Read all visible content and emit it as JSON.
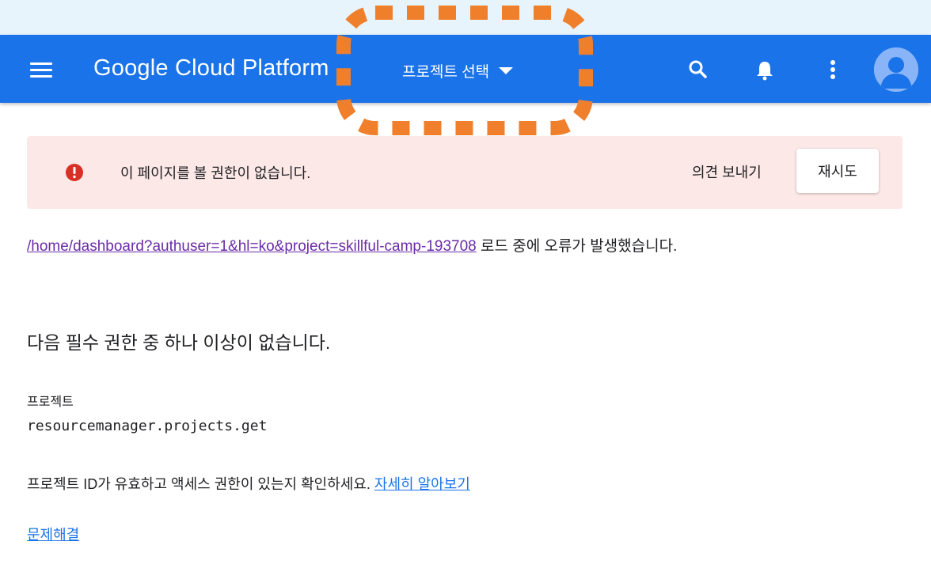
{
  "colors": {
    "appbar": "#1a73e8",
    "highlight": "#f07f2c",
    "alert_bg": "#fce8e6",
    "error_red": "#d93025",
    "link": "#1a73e8",
    "visited_link": "#6b2ba8"
  },
  "appbar": {
    "menu_icon": "hamburger-menu-icon",
    "title": "Google Cloud Platform",
    "project_picker_label": "프로젝트 선택",
    "icons": [
      "search-icon",
      "bell-icon",
      "more-vert-icon",
      "account-avatar-icon"
    ]
  },
  "alert": {
    "icon": "error-icon",
    "message": "이 페이지를 볼 권한이 없습니다.",
    "feedback_label": "의견 보내기",
    "retry_label": "재시도"
  },
  "content": {
    "error_url": "/home/dashboard?authuser=1&hl=ko&project=skillful-camp-193708",
    "error_suffix": " 로드 중에 오류가 발생했습니다.",
    "heading": "다음 필수 권한 중 하나 이상이 없습니다.",
    "permission_group": "프로젝트",
    "permission_name": "resourcemanager.projects.get",
    "hint_text": "프로젝트 ID가 유효하고 액세스 권한이 있는지 확인하세요. ",
    "learn_more_label": "자세히 알아보기",
    "troubleshoot_label": "문제해결"
  }
}
